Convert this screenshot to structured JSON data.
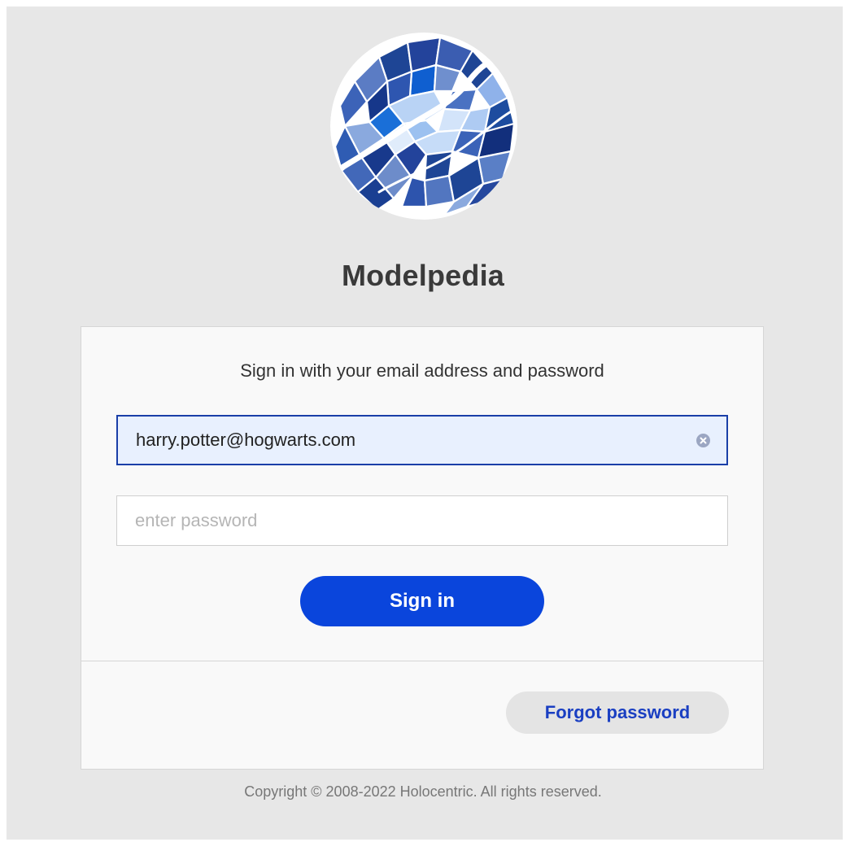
{
  "app": {
    "title": "Modelpedia"
  },
  "login": {
    "subtitle": "Sign in with your email address and password",
    "email_value": "harry.potter@hogwarts.com",
    "password_placeholder": "enter password",
    "signin_label": "Sign in",
    "forgot_label": "Forgot password"
  },
  "footer": {
    "copyright": "Copyright © 2008-2022 Holocentric. All rights reserved."
  },
  "icons": {
    "logo": "mosaic-globe-logo",
    "clear": "clear-circle-icon"
  },
  "colors": {
    "background": "#e7e7e7",
    "card": "#f9f9f9",
    "primary": "#0a45dc",
    "link": "#1a3fc2",
    "email_fill": "#e8f0fe",
    "email_border": "#1a3fa8"
  }
}
